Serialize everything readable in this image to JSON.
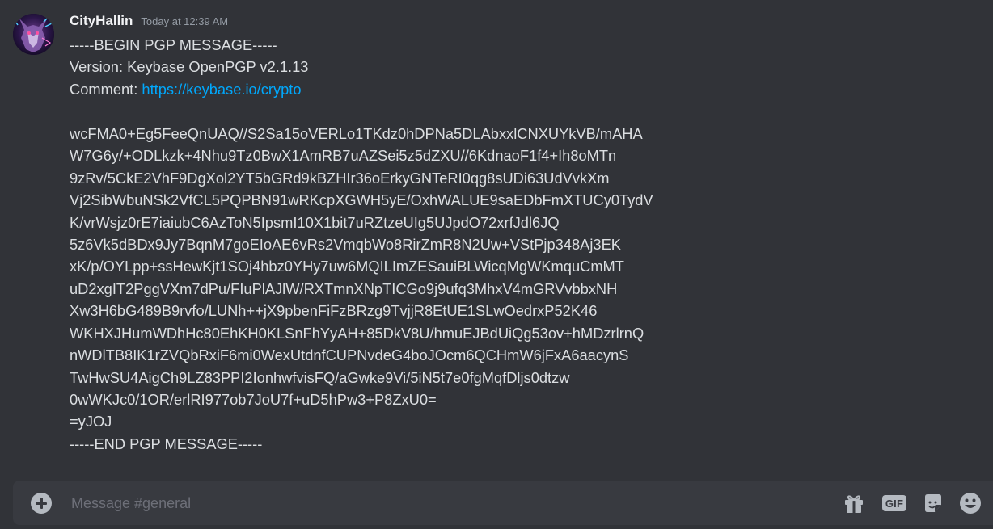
{
  "message": {
    "username": "CityHallin",
    "timestamp": "Today at 12:39 AM",
    "lines": [
      "-----BEGIN PGP MESSAGE-----",
      "Version: Keybase OpenPGP v2.1.13",
      "",
      "",
      "wcFMA0+Eg5FeeQnUAQ//S2Sa15oVERLo1TKdz0hDPNa5DLAbxxlCNXUYkVB/mAHA",
      "W7G6y/+ODLkzk+4Nhu9Tz0BwX1AmRB7uAZSei5z5dZXU//6KdnaoF1f4+Ih8oMTn",
      "9zRv/5CkE2VhF9DgXol2YT5bGRd9kBZHIr36oErkyGNTeRI0qg8sUDi63UdVvkXm",
      "Vj2SibWbuNSk2VfCL5PQPBN91wRKcpXGWH5yE/OxhWALUE9saEDbFmXTUCy0TydV",
      "K/vrWsjz0rE7iaiubC6AzToN5IpsmI10X1bit7uRZtzeUIg5UJpdO72xrfJdl6JQ",
      "5z6Vk5dBDx9Jy7BqnM7goEIoAE6vRs2VmqbWo8RirZmR8N2Uw+VStPjp348Aj3EK",
      "xK/p/OYLpp+ssHewKjt1SOj4hbz0YHy7uw6MQILImZESauiBLWicqMgWKmquCmMT",
      "uD2xgIT2PggVXm7dPu/FIuPlAJlW/RXTmnXNpTICGo9j9ufq3MhxV4mGRVvbbxNH",
      "Xw3H6bG489B9rvfo/LUNh++jX9pbenFiFzBRzg9TvjjR8EtUE1SLwOedrxP52K46",
      "WKHXJHumWDhHc80EhKH0KLSnFhYyAH+85DkV8U/hmuEJBdUiQg53ov+hMDzrlrnQ",
      "nWDlTB8IK1rZVQbRxiF6mi0WexUtdnfCUPNvdeG4boJOcm6QCHmW6jFxA6aacynS",
      "TwHwSU4AigCh9LZ83PPI2IonhwfvisFQ/aGwke9Vi/5iN5t7e0fgMqfDljs0dtzw",
      "0wWKJc0/1OR/erlRI977ob7JoU7f+uD5hPw3+P8ZxU0=",
      "=yJOJ",
      "-----END PGP MESSAGE-----"
    ],
    "comment_label": "Comment: ",
    "comment_link": "https://keybase.io/crypto"
  },
  "composer": {
    "placeholder": "Message #general",
    "value": ""
  },
  "icons": {
    "add": "plus-circle-icon",
    "gift": "gift-icon",
    "gif": "gif-icon",
    "gif_label": "GIF",
    "sticker": "sticker-icon",
    "emoji": "emoji-icon"
  },
  "colors": {
    "background": "#313338",
    "composer_bg": "#383a40",
    "username": "#f2f3f5",
    "text": "#dbdee1",
    "muted": "#949ba4",
    "link": "#00a8fc",
    "icon": "#b5bac1"
  }
}
